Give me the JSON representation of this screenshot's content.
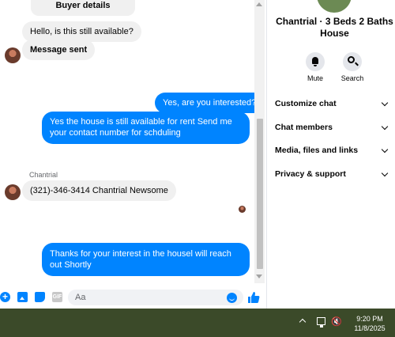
{
  "chat": {
    "messages": {
      "buyer_details": "Buyer details",
      "still_available": "Hello, is this still available?",
      "message_sent": "Message sent",
      "yes_interested": "Yes, are you interested?",
      "available_for_rent": "Yes the house is still available for rent Send me your contact number for schduling",
      "sender_name": "Chantrial",
      "phone_reply": "(321)-346-3414 Chantrial Newsome",
      "thanks": "Thanks for your interest in the housel will reach out Shortly"
    },
    "composer": {
      "placeholder": "Aa",
      "gif_label": "GIF",
      "plus_label": "+"
    }
  },
  "details": {
    "title": "Chantrial · 3 Beds 2 Baths House",
    "mute_label": "Mute",
    "search_label": "Search",
    "sections": [
      {
        "label": "Customize chat"
      },
      {
        "label": "Chat members"
      },
      {
        "label": "Media, files and links"
      },
      {
        "label": "Privacy & support"
      }
    ]
  },
  "taskbar": {
    "time": "9:20 PM",
    "date": "11/8/2025",
    "volume_glyph": "🔇"
  },
  "colors": {
    "accent": "#0084ff",
    "incoming_bubble": "#f0f0f0",
    "taskbar": "#3b4a29"
  }
}
